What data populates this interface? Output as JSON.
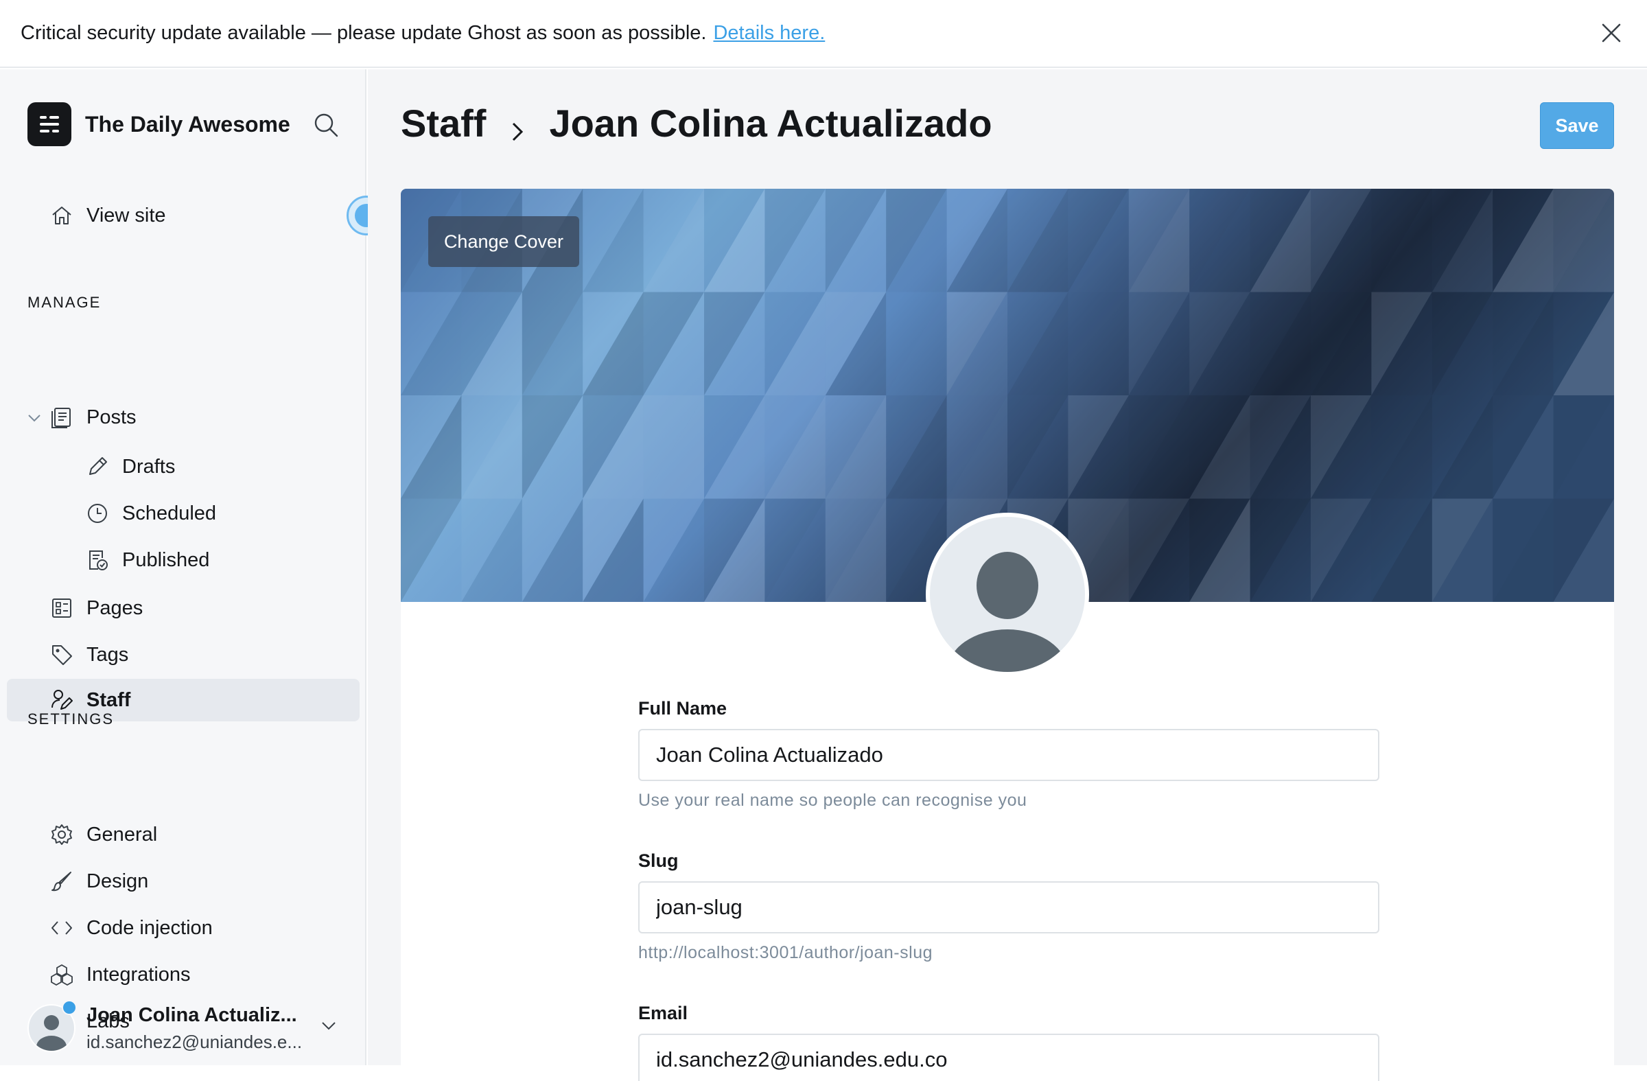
{
  "banner": {
    "message": "Critical security update available — please update Ghost as soon as possible.",
    "link": "Details here."
  },
  "sidebar": {
    "site_name": "The Daily Awesome",
    "view_site": "View site",
    "manage_label": "MANAGE",
    "settings_label": "SETTINGS",
    "posts": "Posts",
    "drafts": "Drafts",
    "scheduled": "Scheduled",
    "published": "Published",
    "pages": "Pages",
    "tags": "Tags",
    "staff": "Staff",
    "general": "General",
    "design": "Design",
    "code_injection": "Code injection",
    "integrations": "Integrations",
    "labs": "Labs",
    "user": {
      "name": "Joan Colina Actualiz...",
      "email": "id.sanchez2@uniandes.e..."
    }
  },
  "header": {
    "breadcrumb_parent": "Staff",
    "breadcrumb_current": "Joan Colina Actualizado",
    "save_label": "Save"
  },
  "cover": {
    "change_cover_label": "Change Cover"
  },
  "form": {
    "full_name_label": "Full Name",
    "full_name_value": "Joan Colina Actualizado",
    "full_name_hint": "Use your real name so people can recognise you",
    "slug_label": "Slug",
    "slug_value": "joan-slug",
    "slug_hint": "http://localhost:3001/author/joan-slug",
    "email_label": "Email",
    "email_value": "id.sanchez2@uniandes.edu.co"
  },
  "colors": {
    "accent": "#3ba0e6",
    "save_button": "#53a9e6",
    "sidebar_bg": "#f6f7f9",
    "active_nav": "#e6e9ee"
  },
  "icons": [
    "close-icon",
    "ghost-logo-icon",
    "search-icon",
    "home-icon",
    "chevron-down-icon",
    "posts-icon",
    "pencil-icon",
    "clock-icon",
    "published-icon",
    "pages-icon",
    "tag-icon",
    "staff-icon",
    "gear-icon",
    "brush-icon",
    "code-icon",
    "integrations-icon",
    "flask-icon",
    "chevron-right-icon",
    "avatar-icon"
  ]
}
